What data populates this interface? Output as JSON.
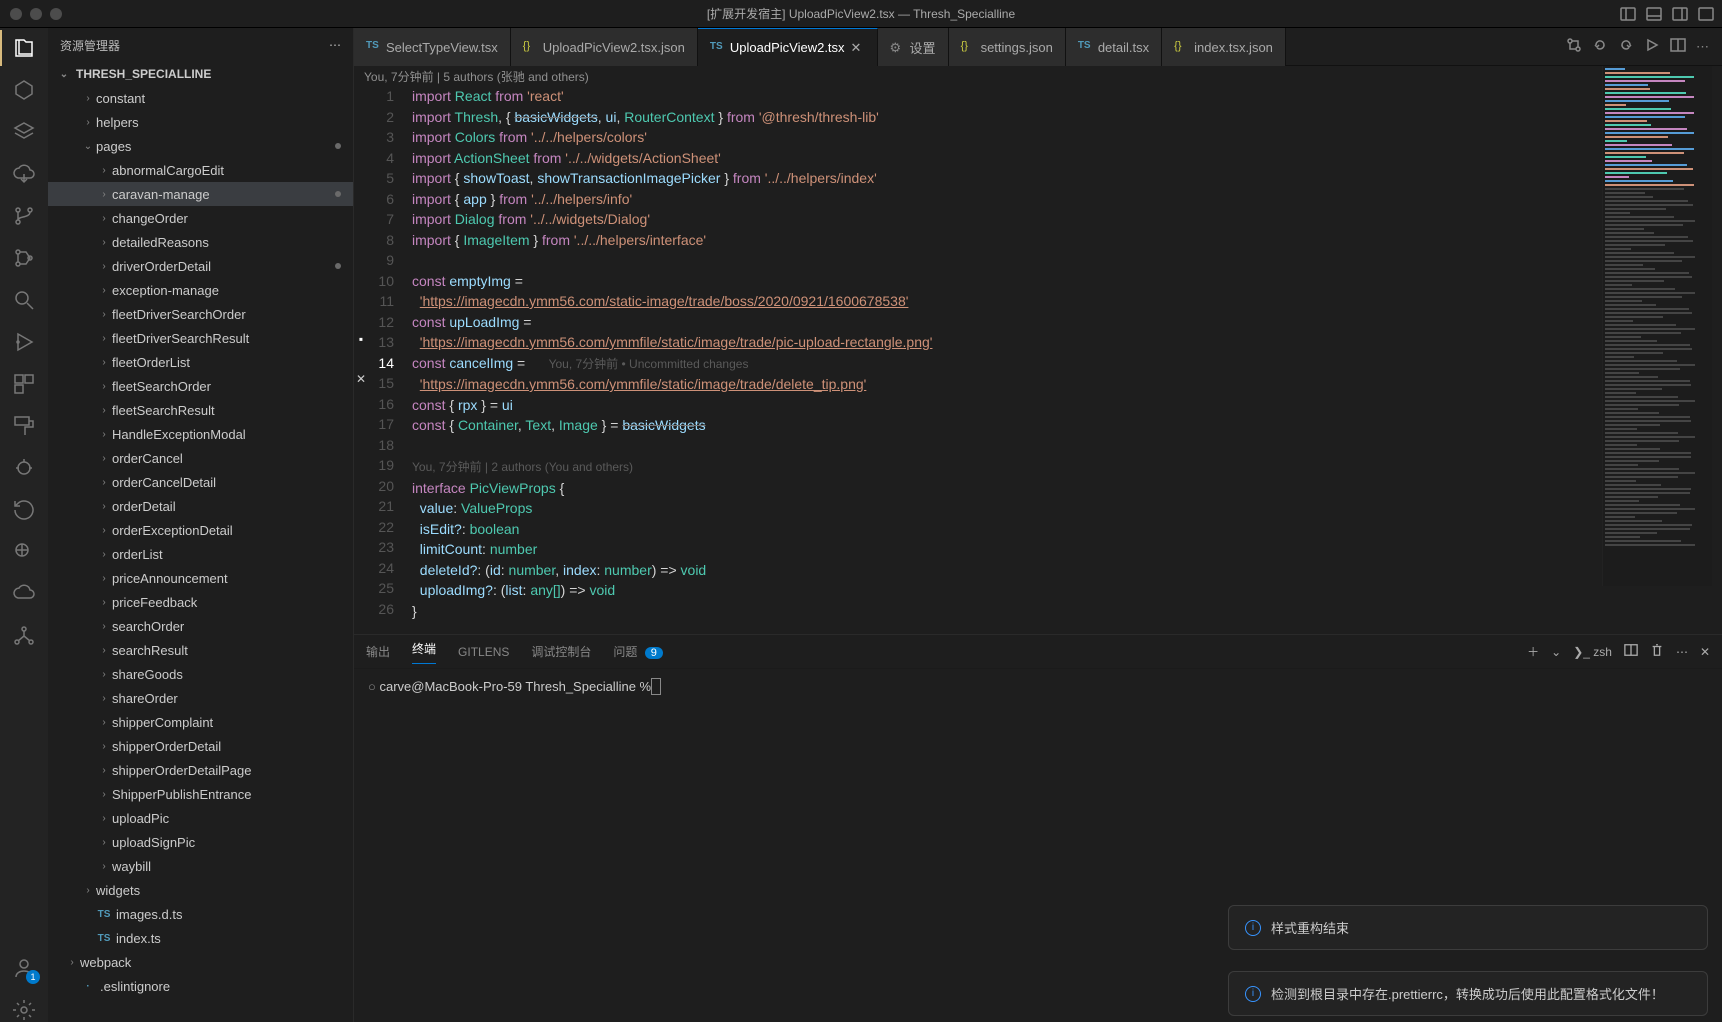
{
  "window": {
    "title": "[扩展开发宿主] UploadPicView2.tsx — Thresh_Specialline"
  },
  "sidebar": {
    "title": "资源管理器",
    "root": "THRESH_SPECIALLINE",
    "folders": [
      {
        "name": "constant",
        "pad": 2,
        "chev": "›"
      },
      {
        "name": "helpers",
        "pad": 2,
        "chev": "›"
      },
      {
        "name": "pages",
        "pad": 2,
        "chev": "⌄",
        "mod": true
      },
      {
        "name": "abnormalCargoEdit",
        "pad": 3,
        "chev": "›"
      },
      {
        "name": "caravan-manage",
        "pad": 3,
        "chev": "›",
        "selected": true,
        "mod": true
      },
      {
        "name": "changeOrder",
        "pad": 3,
        "chev": "›"
      },
      {
        "name": "detailedReasons",
        "pad": 3,
        "chev": "›"
      },
      {
        "name": "driverOrderDetail",
        "pad": 3,
        "chev": "›",
        "mod": true
      },
      {
        "name": "exception-manage",
        "pad": 3,
        "chev": "›"
      },
      {
        "name": "fleetDriverSearchOrder",
        "pad": 3,
        "chev": "›"
      },
      {
        "name": "fleetDriverSearchResult",
        "pad": 3,
        "chev": "›"
      },
      {
        "name": "fleetOrderList",
        "pad": 3,
        "chev": "›"
      },
      {
        "name": "fleetSearchOrder",
        "pad": 3,
        "chev": "›"
      },
      {
        "name": "fleetSearchResult",
        "pad": 3,
        "chev": "›"
      },
      {
        "name": "HandleExceptionModal",
        "pad": 3,
        "chev": "›"
      },
      {
        "name": "orderCancel",
        "pad": 3,
        "chev": "›"
      },
      {
        "name": "orderCancelDetail",
        "pad": 3,
        "chev": "›"
      },
      {
        "name": "orderDetail",
        "pad": 3,
        "chev": "›"
      },
      {
        "name": "orderExceptionDetail",
        "pad": 3,
        "chev": "›"
      },
      {
        "name": "orderList",
        "pad": 3,
        "chev": "›"
      },
      {
        "name": "priceAnnouncement",
        "pad": 3,
        "chev": "›"
      },
      {
        "name": "priceFeedback",
        "pad": 3,
        "chev": "›"
      },
      {
        "name": "searchOrder",
        "pad": 3,
        "chev": "›"
      },
      {
        "name": "searchResult",
        "pad": 3,
        "chev": "›"
      },
      {
        "name": "shareGoods",
        "pad": 3,
        "chev": "›"
      },
      {
        "name": "shareOrder",
        "pad": 3,
        "chev": "›"
      },
      {
        "name": "shipperComplaint",
        "pad": 3,
        "chev": "›"
      },
      {
        "name": "shipperOrderDetail",
        "pad": 3,
        "chev": "›"
      },
      {
        "name": "shipperOrderDetailPage",
        "pad": 3,
        "chev": "›"
      },
      {
        "name": "ShipperPublishEntrance",
        "pad": 3,
        "chev": "›"
      },
      {
        "name": "uploadPic",
        "pad": 3,
        "chev": "›"
      },
      {
        "name": "uploadSignPic",
        "pad": 3,
        "chev": "›"
      },
      {
        "name": "waybill",
        "pad": 3,
        "chev": "›"
      },
      {
        "name": "widgets",
        "pad": 2,
        "chev": "›"
      },
      {
        "name": "images.d.ts",
        "pad": 2,
        "chev": "",
        "ficon": "TS"
      },
      {
        "name": "index.ts",
        "pad": 2,
        "chev": "",
        "ficon": "TS"
      },
      {
        "name": "webpack",
        "pad": 1,
        "chev": "›"
      },
      {
        "name": ".eslintignore",
        "pad": 1,
        "chev": "",
        "ficon": "·"
      }
    ]
  },
  "activity": {
    "badge_account": "1"
  },
  "tabs": {
    "items": [
      {
        "label": "SelectTypeView.tsx",
        "icon": "TS"
      },
      {
        "label": "UploadPicView2.tsx.json",
        "icon": "{}"
      },
      {
        "label": "UploadPicView2.tsx",
        "icon": "TS",
        "active": true,
        "close": true
      },
      {
        "label": "设置",
        "icon": "⚙"
      },
      {
        "label": "settings.json",
        "icon": "{}"
      },
      {
        "label": "detail.tsx",
        "icon": "TS"
      },
      {
        "label": "index.tsx.json",
        "icon": "{}"
      }
    ]
  },
  "editor": {
    "blame_top": "You, 7分钟前 | 5 authors (张驰 and others)",
    "blame_mid": "You, 7分钟前 | 2 authors (You and others)",
    "inline_blame": "You, 7分钟前 • Uncommitted changes",
    "lines": [
      [
        {
          "c": "kw",
          "t": "import "
        },
        {
          "c": "typ",
          "t": "React"
        },
        {
          "c": "",
          "t": " "
        },
        {
          "c": "kw",
          "t": "from"
        },
        {
          "c": "",
          "t": " "
        },
        {
          "c": "str",
          "t": "'react'"
        }
      ],
      [
        {
          "c": "kw",
          "t": "import "
        },
        {
          "c": "typ",
          "t": "Thresh"
        },
        {
          "c": "",
          "t": ", { "
        },
        {
          "c": "fn strike",
          "t": "basicWidgets"
        },
        {
          "c": "",
          "t": ", "
        },
        {
          "c": "fn",
          "t": "ui"
        },
        {
          "c": "",
          "t": ", "
        },
        {
          "c": "typ",
          "t": "RouterContext"
        },
        {
          "c": "",
          "t": " } "
        },
        {
          "c": "kw",
          "t": "from"
        },
        {
          "c": "",
          "t": " "
        },
        {
          "c": "str",
          "t": "'@thresh/thresh-lib'"
        }
      ],
      [
        {
          "c": "kw",
          "t": "import "
        },
        {
          "c": "typ",
          "t": "Colors"
        },
        {
          "c": "",
          "t": " "
        },
        {
          "c": "kw",
          "t": "from"
        },
        {
          "c": "",
          "t": " "
        },
        {
          "c": "str",
          "t": "'../../helpers/colors'"
        }
      ],
      [
        {
          "c": "kw",
          "t": "import "
        },
        {
          "c": "typ",
          "t": "ActionSheet"
        },
        {
          "c": "",
          "t": " "
        },
        {
          "c": "kw",
          "t": "from"
        },
        {
          "c": "",
          "t": " "
        },
        {
          "c": "str",
          "t": "'../../widgets/ActionSheet'"
        }
      ],
      [
        {
          "c": "kw",
          "t": "import "
        },
        {
          "c": "",
          "t": "{ "
        },
        {
          "c": "fn",
          "t": "showToast"
        },
        {
          "c": "",
          "t": ", "
        },
        {
          "c": "fn",
          "t": "showTransactionImagePicker"
        },
        {
          "c": "",
          "t": " } "
        },
        {
          "c": "kw",
          "t": "from"
        },
        {
          "c": "",
          "t": " "
        },
        {
          "c": "str",
          "t": "'../../helpers/index'"
        }
      ],
      [
        {
          "c": "kw",
          "t": "import "
        },
        {
          "c": "",
          "t": "{ "
        },
        {
          "c": "fn",
          "t": "app"
        },
        {
          "c": "",
          "t": " } "
        },
        {
          "c": "kw",
          "t": "from"
        },
        {
          "c": "",
          "t": " "
        },
        {
          "c": "str",
          "t": "'../../helpers/info'"
        }
      ],
      [
        {
          "c": "kw",
          "t": "import "
        },
        {
          "c": "typ",
          "t": "Dialog"
        },
        {
          "c": "",
          "t": " "
        },
        {
          "c": "kw",
          "t": "from"
        },
        {
          "c": "",
          "t": " "
        },
        {
          "c": "str",
          "t": "'../../widgets/Dialog'"
        }
      ],
      [
        {
          "c": "kw",
          "t": "import "
        },
        {
          "c": "",
          "t": "{ "
        },
        {
          "c": "typ",
          "t": "ImageItem"
        },
        {
          "c": "",
          "t": " } "
        },
        {
          "c": "kw",
          "t": "from"
        },
        {
          "c": "",
          "t": " "
        },
        {
          "c": "str",
          "t": "'../../helpers/interface'"
        }
      ],
      [
        {
          "c": "",
          "t": ""
        }
      ],
      [
        {
          "c": "kw",
          "t": "const "
        },
        {
          "c": "var",
          "t": "emptyImg"
        },
        {
          "c": "",
          "t": " ="
        }
      ],
      [
        {
          "c": "",
          "t": "  "
        },
        {
          "c": "str url",
          "t": "'https://imagecdn.ymm56.com/static-image/trade/boss/2020/0921/1600678538'"
        }
      ],
      [
        {
          "c": "kw",
          "t": "const "
        },
        {
          "c": "var",
          "t": "upLoadImg"
        },
        {
          "c": "",
          "t": " ="
        }
      ],
      [
        {
          "c": "",
          "t": "  "
        },
        {
          "c": "str url",
          "t": "'https://imagecdn.ymm56.com/ymmfile/static/image/trade/pic-upload-rectangle.png'"
        }
      ],
      [
        {
          "c": "kw",
          "t": "const "
        },
        {
          "c": "var",
          "t": "cancelImg"
        },
        {
          "c": "",
          "t": " ="
        },
        {
          "c": "",
          "t": "      "
        },
        {
          "c": "inlinecom",
          "t": "You, 7分钟前 • Uncommitted changes"
        }
      ],
      [
        {
          "c": "",
          "t": "  "
        },
        {
          "c": "str url",
          "t": "'https://imagecdn.ymm56.com/ymmfile/static/image/trade/delete_tip.png'"
        }
      ],
      [
        {
          "c": "kw",
          "t": "const "
        },
        {
          "c": "",
          "t": "{ "
        },
        {
          "c": "fn",
          "t": "rpx"
        },
        {
          "c": "",
          "t": " } = "
        },
        {
          "c": "fn",
          "t": "ui"
        }
      ],
      [
        {
          "c": "kw",
          "t": "const "
        },
        {
          "c": "",
          "t": "{ "
        },
        {
          "c": "typ",
          "t": "Container"
        },
        {
          "c": "",
          "t": ", "
        },
        {
          "c": "typ",
          "t": "Text"
        },
        {
          "c": "",
          "t": ", "
        },
        {
          "c": "typ",
          "t": "Image"
        },
        {
          "c": "",
          "t": " } = "
        },
        {
          "c": "fn strike",
          "t": "basicWidgets"
        }
      ],
      [
        {
          "c": "",
          "t": ""
        }
      ],
      [
        {
          "c": "inlinecom",
          "t": "You, 7分钟前 | 2 authors (You and others)"
        }
      ],
      [
        {
          "c": "kw",
          "t": "interface "
        },
        {
          "c": "typ",
          "t": "PicViewProps"
        },
        {
          "c": "",
          "t": " {"
        }
      ],
      [
        {
          "c": "",
          "t": "  "
        },
        {
          "c": "fn",
          "t": "value"
        },
        {
          "c": "",
          "t": ": "
        },
        {
          "c": "typ",
          "t": "ValueProps"
        }
      ],
      [
        {
          "c": "",
          "t": "  "
        },
        {
          "c": "fn",
          "t": "isEdit?"
        },
        {
          "c": "",
          "t": ": "
        },
        {
          "c": "typ",
          "t": "boolean"
        }
      ],
      [
        {
          "c": "",
          "t": "  "
        },
        {
          "c": "fn",
          "t": "limitCount"
        },
        {
          "c": "",
          "t": ": "
        },
        {
          "c": "typ",
          "t": "number"
        }
      ],
      [
        {
          "c": "",
          "t": "  "
        },
        {
          "c": "fn",
          "t": "deleteId?"
        },
        {
          "c": "",
          "t": ": ("
        },
        {
          "c": "fn",
          "t": "id"
        },
        {
          "c": "",
          "t": ": "
        },
        {
          "c": "typ",
          "t": "number"
        },
        {
          "c": "",
          "t": ", "
        },
        {
          "c": "fn",
          "t": "index"
        },
        {
          "c": "",
          "t": ": "
        },
        {
          "c": "typ",
          "t": "number"
        },
        {
          "c": "",
          "t": ") => "
        },
        {
          "c": "typ",
          "t": "void"
        }
      ],
      [
        {
          "c": "",
          "t": "  "
        },
        {
          "c": "fn",
          "t": "uploadImg?"
        },
        {
          "c": "",
          "t": ": ("
        },
        {
          "c": "fn",
          "t": "list"
        },
        {
          "c": "",
          "t": ": "
        },
        {
          "c": "typ",
          "t": "any[]"
        },
        {
          "c": "",
          "t": ") => "
        },
        {
          "c": "typ",
          "t": "void"
        }
      ],
      [
        {
          "c": "",
          "t": "}"
        }
      ],
      [
        {
          "c": "",
          "t": ""
        }
      ]
    ],
    "line_count": 26,
    "current_line": 14
  },
  "panel": {
    "tabs": {
      "output": "输出",
      "terminal": "终端",
      "gitlens": "GITLENS",
      "debug": "调试控制台",
      "problems": "问题",
      "problems_count": "9"
    },
    "shell": "zsh",
    "prompt": "carve@MacBook-Pro-59 Thresh_Specialline % "
  },
  "toasts": {
    "t1": "样式重构结束",
    "t2": "检测到根目录中存在.prettierrc，转换成功后使用此配置格式化文件！"
  }
}
